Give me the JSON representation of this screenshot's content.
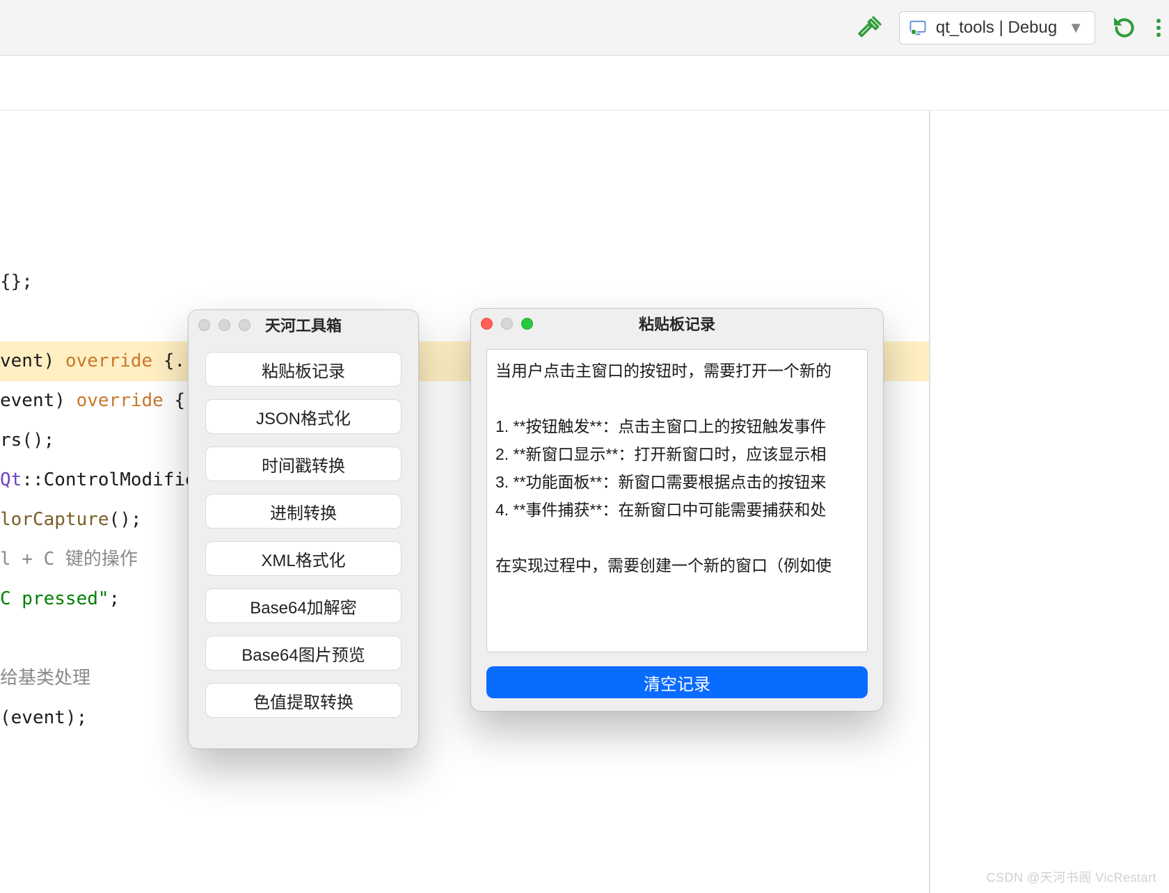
{
  "ide": {
    "run_config_label": "qt_tools | Debug",
    "code_lines": [
      {
        "raw": "{};",
        "cls": ""
      },
      {
        "raw": "",
        "cls": ""
      },
      {
        "raw": "vent) override {..",
        "cls": "hl",
        "tokens": [
          {
            "t": "vent",
            "c": "id"
          },
          {
            "t": ") ",
            "c": ""
          },
          {
            "t": "override",
            "c": "kw"
          },
          {
            "t": " {..",
            "c": ""
          }
        ]
      },
      {
        "raw": "event) override {",
        "tokens": [
          {
            "t": "event",
            "c": "id"
          },
          {
            "t": ") ",
            "c": ""
          },
          {
            "t": "override",
            "c": "kw"
          },
          {
            "t": " {",
            "c": ""
          }
        ]
      },
      {
        "raw": "rs();",
        "tokens": [
          {
            "t": "rs",
            "c": "id"
          },
          {
            "t": "();",
            "c": ""
          }
        ]
      },
      {
        "raw": "Qt::ControlModifie",
        "tokens": [
          {
            "t": "Qt",
            "c": "qt"
          },
          {
            "t": "::",
            "c": ""
          },
          {
            "t": "ControlModifie",
            "c": "id"
          }
        ]
      },
      {
        "raw": "lorCapture();",
        "tokens": [
          {
            "t": "lorCapture",
            "c": "fn"
          },
          {
            "t": "();",
            "c": ""
          }
        ]
      },
      {
        "raw": "l + C 键的操作",
        "tokens": [
          {
            "t": "l + C 键的操作",
            "c": "cmt"
          }
        ]
      },
      {
        "raw": "C pressed\";",
        "tokens": [
          {
            "t": "C pressed\"",
            "c": "str"
          },
          {
            "t": ";",
            "c": ""
          }
        ]
      },
      {
        "raw": "",
        "cls": ""
      },
      {
        "raw": "给基类处理",
        "tokens": [
          {
            "t": "给基类处理",
            "c": "cmt"
          }
        ]
      },
      {
        "raw": "(event);",
        "tokens": [
          {
            "t": "(",
            "c": ""
          },
          {
            "t": "event",
            "c": "id"
          },
          {
            "t": ");",
            "c": ""
          }
        ]
      }
    ],
    "mid_fragment": "Qt::"
  },
  "toolbox": {
    "title": "天河工具箱",
    "buttons": [
      "粘贴板记录",
      "JSON格式化",
      "时间戳转换",
      "进制转换",
      "XML格式化",
      "Base64加解密",
      "Base64图片预览",
      "色值提取转换"
    ]
  },
  "clipwin": {
    "title": "粘贴板记录",
    "text": "当用户点击主窗口的按钮时，需要打开一个新的\n\n1. **按钮触发**：点击主窗口上的按钮触发事件\n2. **新窗口显示**：打开新窗口时，应该显示相\n3. **功能面板**：新窗口需要根据点击的按钮来\n4. **事件捕获**：在新窗口中可能需要捕获和处\n\n在实现过程中，需要创建一个新的窗口（例如使",
    "clear_label": "清空记录"
  },
  "watermark": "CSDN @天河书阁 VicRestart"
}
